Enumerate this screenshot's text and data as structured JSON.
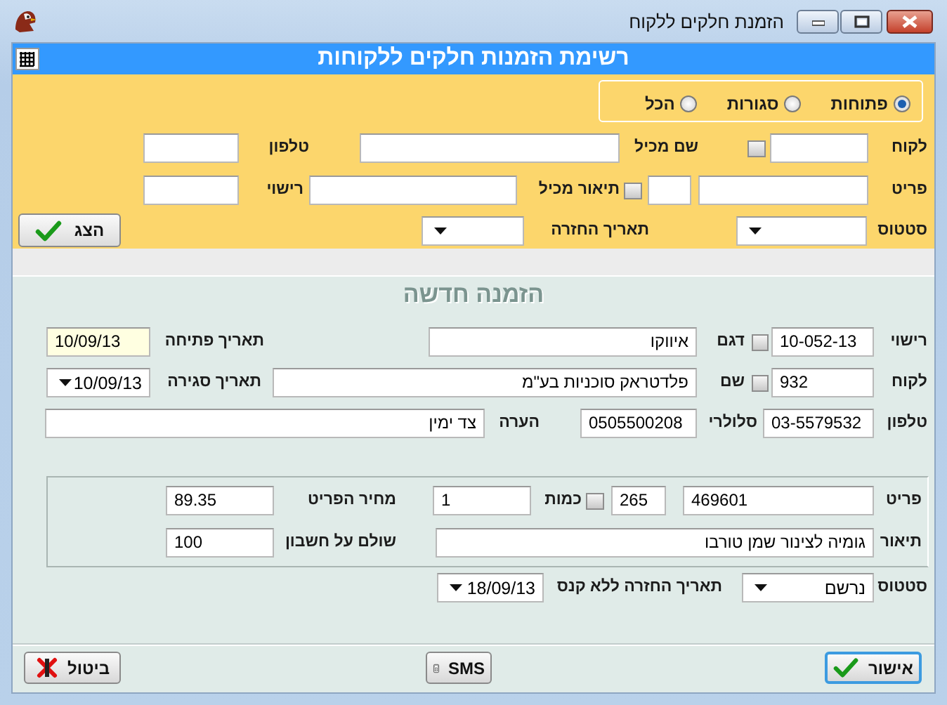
{
  "window": {
    "title": "הזמנת חלקים ללקוח"
  },
  "header": {
    "title": "רשימת הזמנות חלקים ללקוחות"
  },
  "filter": {
    "status_options": [
      {
        "label": "פתוחות",
        "selected": true
      },
      {
        "label": "סגורות",
        "selected": false
      },
      {
        "label": "הכל",
        "selected": false
      }
    ],
    "rows": [
      {
        "items": [
          {
            "kind": "label",
            "text": "לקוח"
          },
          {
            "kind": "field"
          },
          {
            "kind": "check",
            "checked": false
          },
          {
            "kind": "label",
            "text": "שם מכיל"
          },
          {
            "kind": "field"
          },
          {
            "kind": "label",
            "text": "טלפון"
          },
          {
            "kind": "field"
          }
        ]
      },
      {
        "items": [
          {
            "kind": "label",
            "text": "פריט"
          },
          {
            "kind": "field"
          },
          {
            "kind": "field"
          },
          {
            "kind": "check",
            "checked": false
          },
          {
            "kind": "label",
            "text": "תיאור מכיל"
          },
          {
            "kind": "field"
          },
          {
            "kind": "label",
            "text": "רישוי"
          },
          {
            "kind": "field"
          }
        ]
      },
      {
        "items": [
          {
            "kind": "label",
            "text": "סטטוס"
          },
          {
            "kind": "combo"
          },
          {
            "kind": "label",
            "text": "תאריך החזרה"
          },
          {
            "kind": "combo"
          },
          {
            "kind": "button",
            "label": "הצג"
          }
        ]
      }
    ]
  },
  "order": {
    "title": "הזמנה חדשה",
    "rows": [
      {
        "items": [
          {
            "kind": "label",
            "text": "רישוי"
          },
          {
            "kind": "field",
            "value": "10-052-13",
            "highlighted": false
          },
          {
            "kind": "check",
            "checked": false
          },
          {
            "kind": "label",
            "text": "דגם"
          },
          {
            "kind": "field",
            "value": "איווקו",
            "highlighted": false
          },
          {
            "kind": "label",
            "text": "תאריך פתיחה"
          },
          {
            "kind": "field",
            "value": "10/09/13",
            "highlighted": true
          }
        ]
      },
      {
        "items": [
          {
            "kind": "label",
            "text": "לקוח"
          },
          {
            "kind": "field",
            "value": "932",
            "highlighted": false
          },
          {
            "kind": "check",
            "checked": false
          },
          {
            "kind": "label",
            "text": "שם"
          },
          {
            "kind": "field",
            "value": "פלדטראק סוכניות בע\"מ",
            "highlighted": false
          },
          {
            "kind": "label",
            "text": "תאריך סגירה"
          },
          {
            "kind": "combo",
            "value": "10/09/13"
          }
        ]
      },
      {
        "items": [
          {
            "kind": "label",
            "text": "טלפון"
          },
          {
            "kind": "field",
            "value": "03-5579532",
            "highlighted": false
          },
          {
            "kind": "label",
            "text": "סלולרי"
          },
          {
            "kind": "field",
            "value": "0505500208",
            "highlighted": false
          },
          {
            "kind": "label",
            "text": "הערה"
          },
          {
            "kind": "field",
            "value": "צד ימין",
            "highlighted": false
          }
        ]
      }
    ],
    "item_rows": [
      {
        "items": [
          {
            "kind": "label",
            "text": "פריט"
          },
          {
            "kind": "field",
            "value": "469601",
            "highlighted": false
          },
          {
            "kind": "field",
            "value": "265",
            "highlighted": false
          },
          {
            "kind": "check",
            "checked": false
          },
          {
            "kind": "label",
            "text": "כמות"
          },
          {
            "kind": "field",
            "value": "1",
            "highlighted": false
          },
          {
            "kind": "label",
            "text": "מחיר הפריט"
          },
          {
            "kind": "field",
            "value": "89.35",
            "highlighted": false
          }
        ]
      },
      {
        "items": [
          {
            "kind": "label",
            "text": "תיאור"
          },
          {
            "kind": "field",
            "value": "גומיה לצינור שמן טורבו",
            "highlighted": false
          },
          {
            "kind": "label",
            "text": "שולם על חשבון"
          },
          {
            "kind": "field",
            "value": "100",
            "highlighted": false
          }
        ]
      }
    ],
    "status_row": {
      "items": [
        {
          "kind": "label",
          "text": "סטטוס"
        },
        {
          "kind": "combo",
          "value": "נרשם"
        },
        {
          "kind": "label",
          "text": "תאריך החזרה ללא קנס"
        },
        {
          "kind": "combo",
          "value": "18/09/13"
        }
      ]
    }
  },
  "buttons": [
    {
      "kind": "ok",
      "label": "אישור",
      "focused": true
    },
    {
      "kind": "sms",
      "label": "SMS",
      "focused": false
    },
    {
      "kind": "cancel",
      "label": "ביטול",
      "focused": false
    }
  ]
}
